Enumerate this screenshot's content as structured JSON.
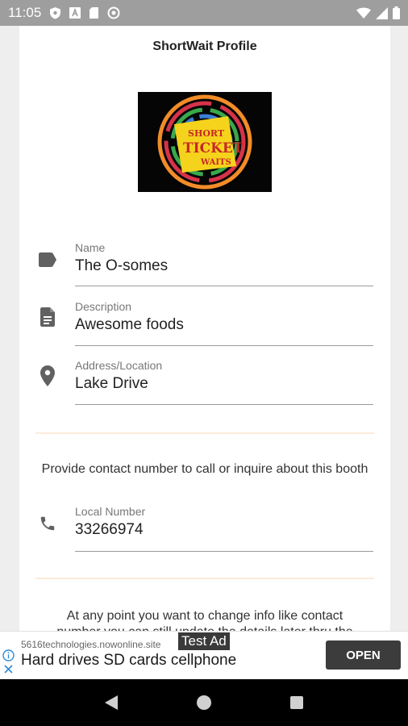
{
  "status_bar": {
    "time": "11:05",
    "icons": [
      "shield-icon",
      "font-a-icon",
      "sd-card-icon",
      "at-sign-icon"
    ],
    "right_icons": [
      "wifi-icon",
      "signal-icon",
      "battery-icon"
    ]
  },
  "page": {
    "title": "ShortWait Profile",
    "logo_text": {
      "line1": "SHORT",
      "line2": "TICKET",
      "line3": "WAITS"
    }
  },
  "fields": {
    "name": {
      "label": "Name",
      "value": "The O-somes",
      "icon": "label-tag-icon"
    },
    "description": {
      "label": "Description",
      "value": "Awesome foods",
      "icon": "document-icon"
    },
    "address": {
      "label": "Address/Location",
      "value": "Lake Drive",
      "icon": "location-pin-icon"
    },
    "local_number": {
      "label": "Local Number",
      "value": "33266974",
      "icon": "phone-icon"
    }
  },
  "contact_prompt": "Provide contact number to call or inquire about this booth",
  "change_info_text_line1": "At any point you want to change info like contact",
  "change_info_text_line2": "number you can still update the details later thru the",
  "ad": {
    "url": "5616technologies.nowonline.site",
    "badge": "Test Ad",
    "headline": "Hard drives SD cards cellphone",
    "button_label": "OPEN"
  },
  "navigation": [
    "back-icon",
    "home-icon",
    "recents-icon"
  ],
  "colors": {
    "status_bar": "#9e9e9e",
    "divider": "#fcebd8",
    "icon_gray": "#616161",
    "ad_button": "#3c3c3c"
  }
}
